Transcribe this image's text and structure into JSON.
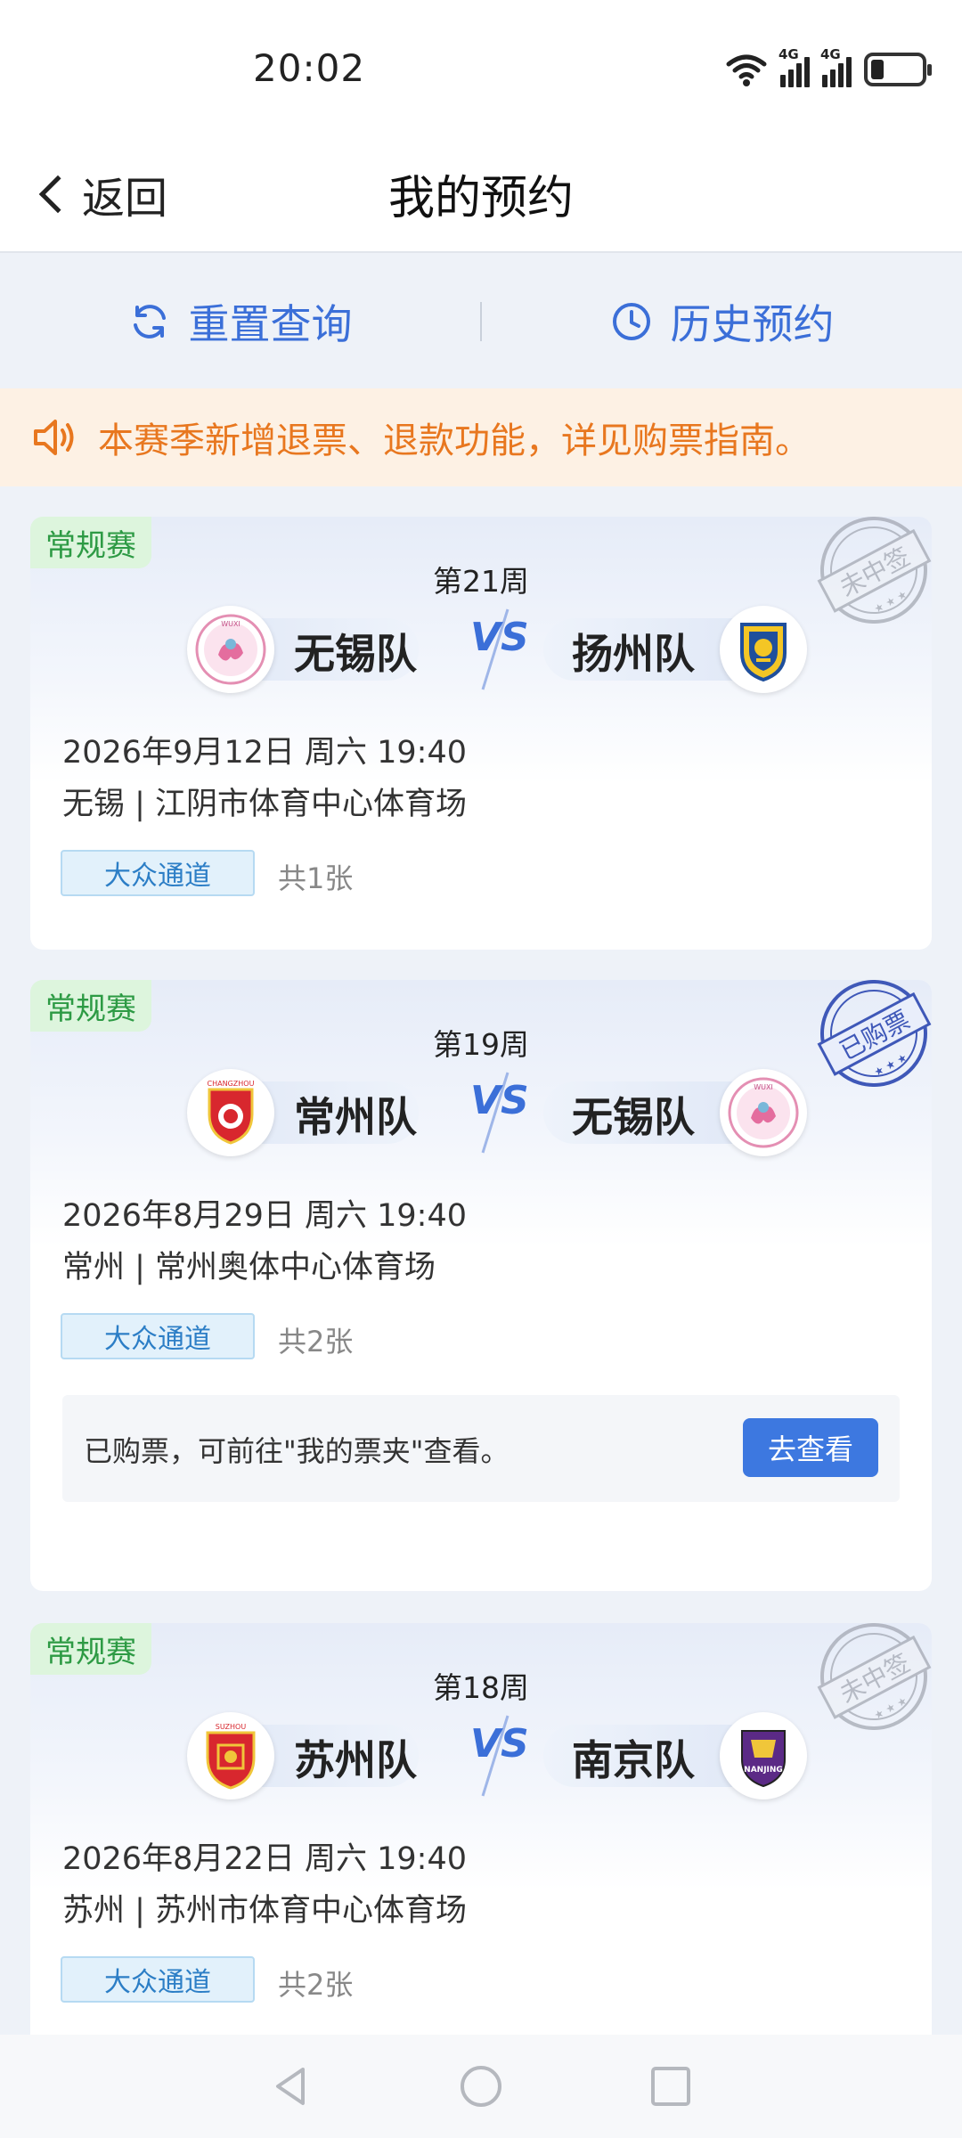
{
  "status_bar": {
    "time": "20:02",
    "net1": "4G",
    "net2": "4G"
  },
  "header": {
    "back_label": "返回",
    "title": "我的预约"
  },
  "actions": {
    "reset_label": "重置查询",
    "history_label": "历史预约"
  },
  "notice": {
    "text": "本赛季新增退票、退款功能，详见购票指南。"
  },
  "colors": {
    "accent": "#3b6fd8",
    "notice": "#e8771f",
    "tag_green": "#2d9a44",
    "button": "#3d78e0"
  },
  "cards": [
    {
      "tag": "常规赛",
      "round": "第21周",
      "home": {
        "name": "无锡队",
        "logo": "wuxi-logo"
      },
      "away": {
        "name": "扬州队",
        "logo": "yangzhou-logo"
      },
      "time": "2026年9月12日 周六 19:40",
      "venue": "无锡 | 江阴市体育中心体育场",
      "channel": "大众通道",
      "count": "共1张",
      "stamp": "未中签"
    },
    {
      "tag": "常规赛",
      "round": "第19周",
      "home": {
        "name": "常州队",
        "logo": "changzhou-logo"
      },
      "away": {
        "name": "无锡队",
        "logo": "wuxi-logo"
      },
      "time": "2026年8月29日 周六 19:40",
      "venue": "常州 | 常州奥体中心体育场",
      "channel": "大众通道",
      "count": "共2张",
      "stamp": "已购票",
      "info_text": "已购票，可前往\"我的票夹\"查看。",
      "info_button": "去查看"
    },
    {
      "tag": "常规赛",
      "round": "第18周",
      "home": {
        "name": "苏州队",
        "logo": "suzhou-logo"
      },
      "away": {
        "name": "南京队",
        "logo": "nanjing-logo"
      },
      "time": "2026年8月22日 周六 19:40",
      "venue": "苏州 | 苏州市体育中心体育场",
      "channel": "大众通道",
      "count": "共2张",
      "stamp": "未中签"
    }
  ],
  "logo_text": {
    "wuxi": "WUXI",
    "changzhou": "CHANGZHOU",
    "suzhou": "SUZHOU",
    "nanjing": "NANJING"
  },
  "vs_text": "VS"
}
